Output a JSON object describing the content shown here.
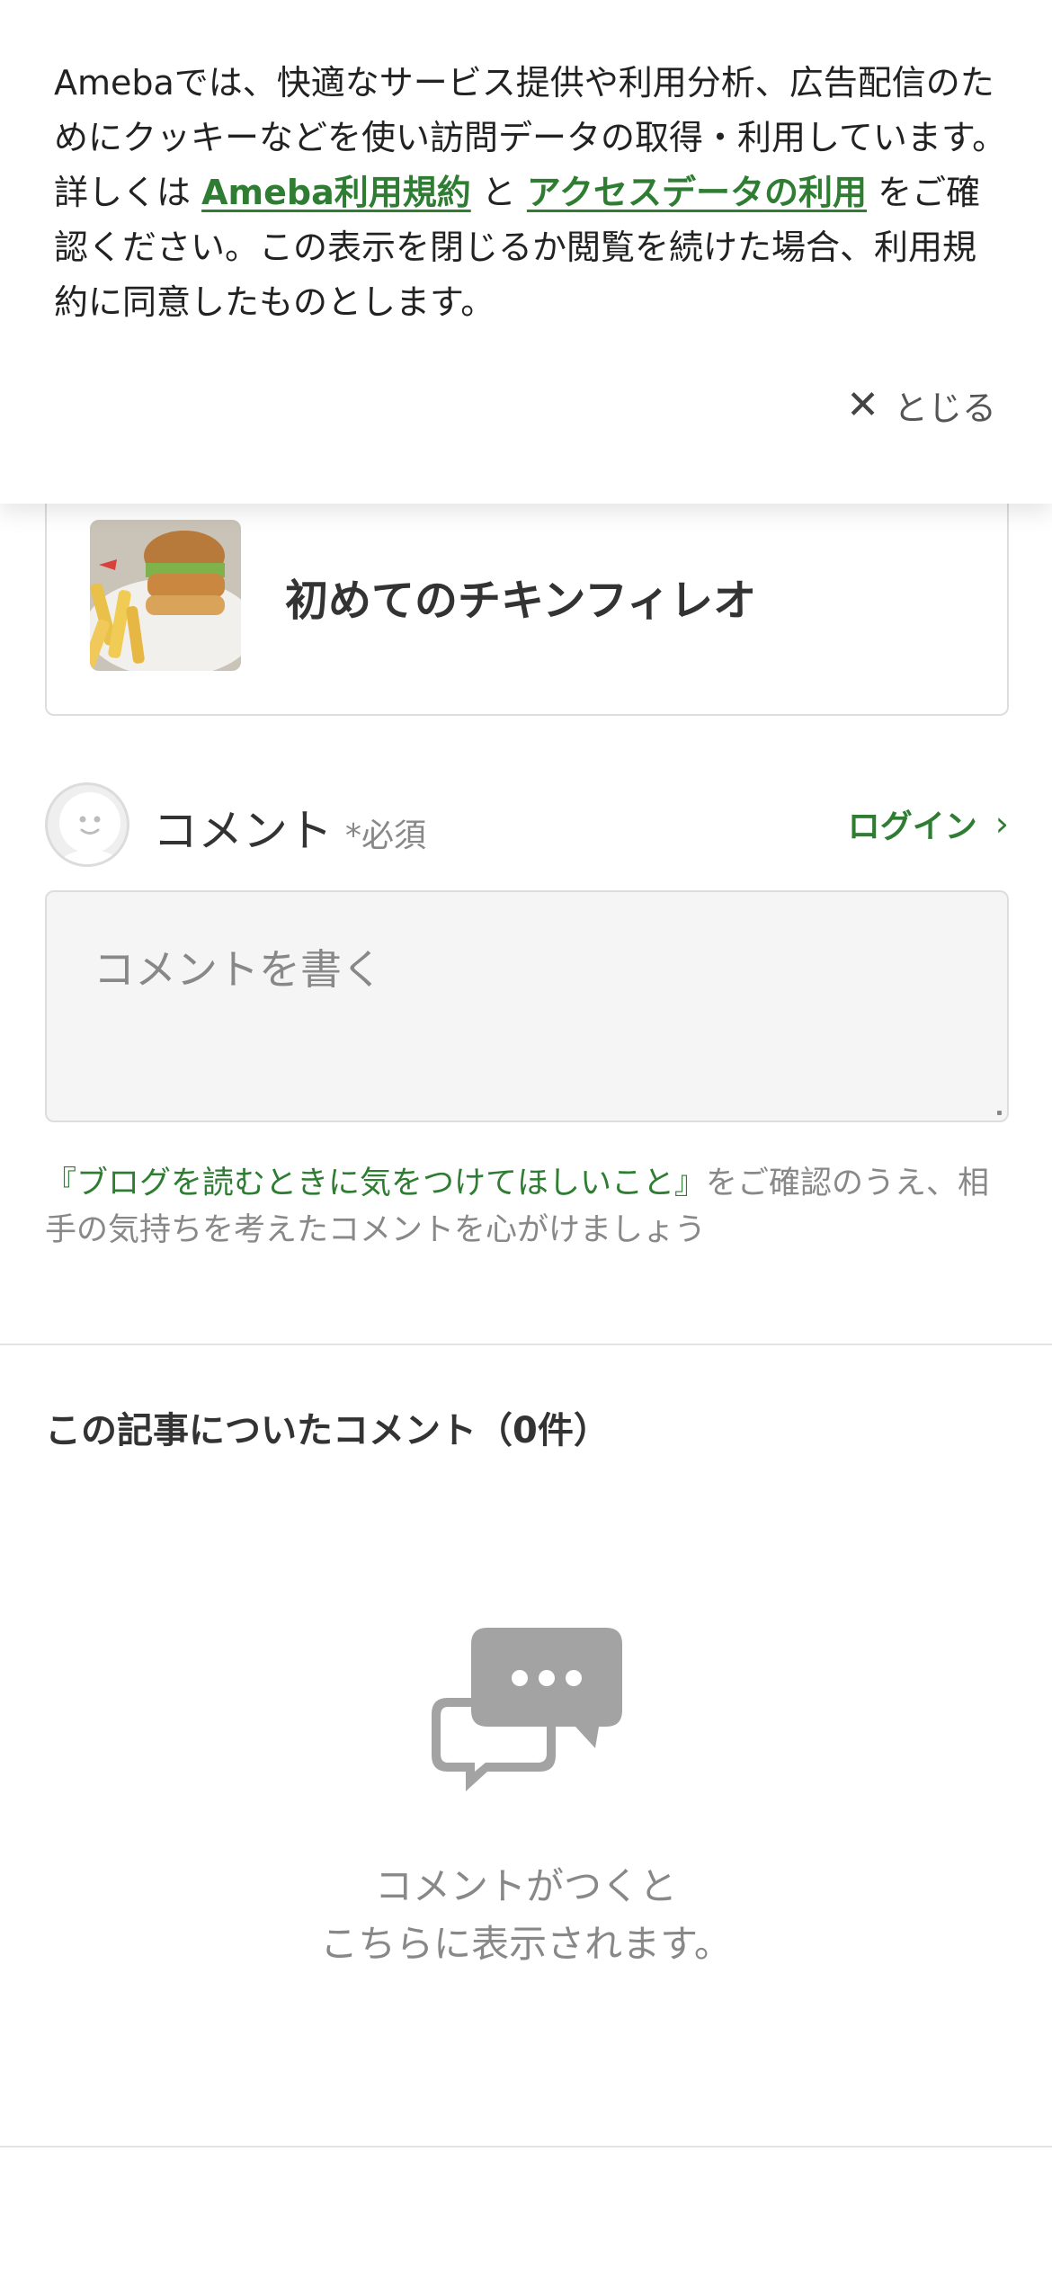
{
  "cookie_banner": {
    "text_before": "Amebaでは、快適なサービス提供や利用分析、広告配信のためにクッキーなどを使い訪問データの取得・利用しています。詳しくは ",
    "link_terms": "Ameba利用規約",
    "text_between": " と ",
    "link_access": "アクセスデータの利用",
    "text_after": " をご確認ください。この表示を閉じるか閲覧を続けた場合、利用規約に同意したものとします。",
    "close_label": "とじる",
    "close_icon": "close-icon"
  },
  "article": {
    "title": "初めてのチキンフィレオ",
    "thumbnail_icon": "food-photo"
  },
  "comment_form": {
    "label": "コメント",
    "required": "*必須",
    "login_label": "ログイン",
    "placeholder": "コメントを書く",
    "guidelines_link": "『ブログを読むときに気をつけてほしいこと』",
    "guidelines_text": "をご確認のうえ、相手の気持ちを考えたコメントを心がけましょう"
  },
  "comments": {
    "section_title": "この記事についたコメント（0件）",
    "empty_line1": "コメントがつくと",
    "empty_line2": "こちらに表示されます。",
    "empty_icon": "comment-bubbles-icon"
  },
  "colors": {
    "accent_green": "#2e7d32",
    "muted_text": "#888888",
    "icon_gray": "#a3a3a3"
  }
}
